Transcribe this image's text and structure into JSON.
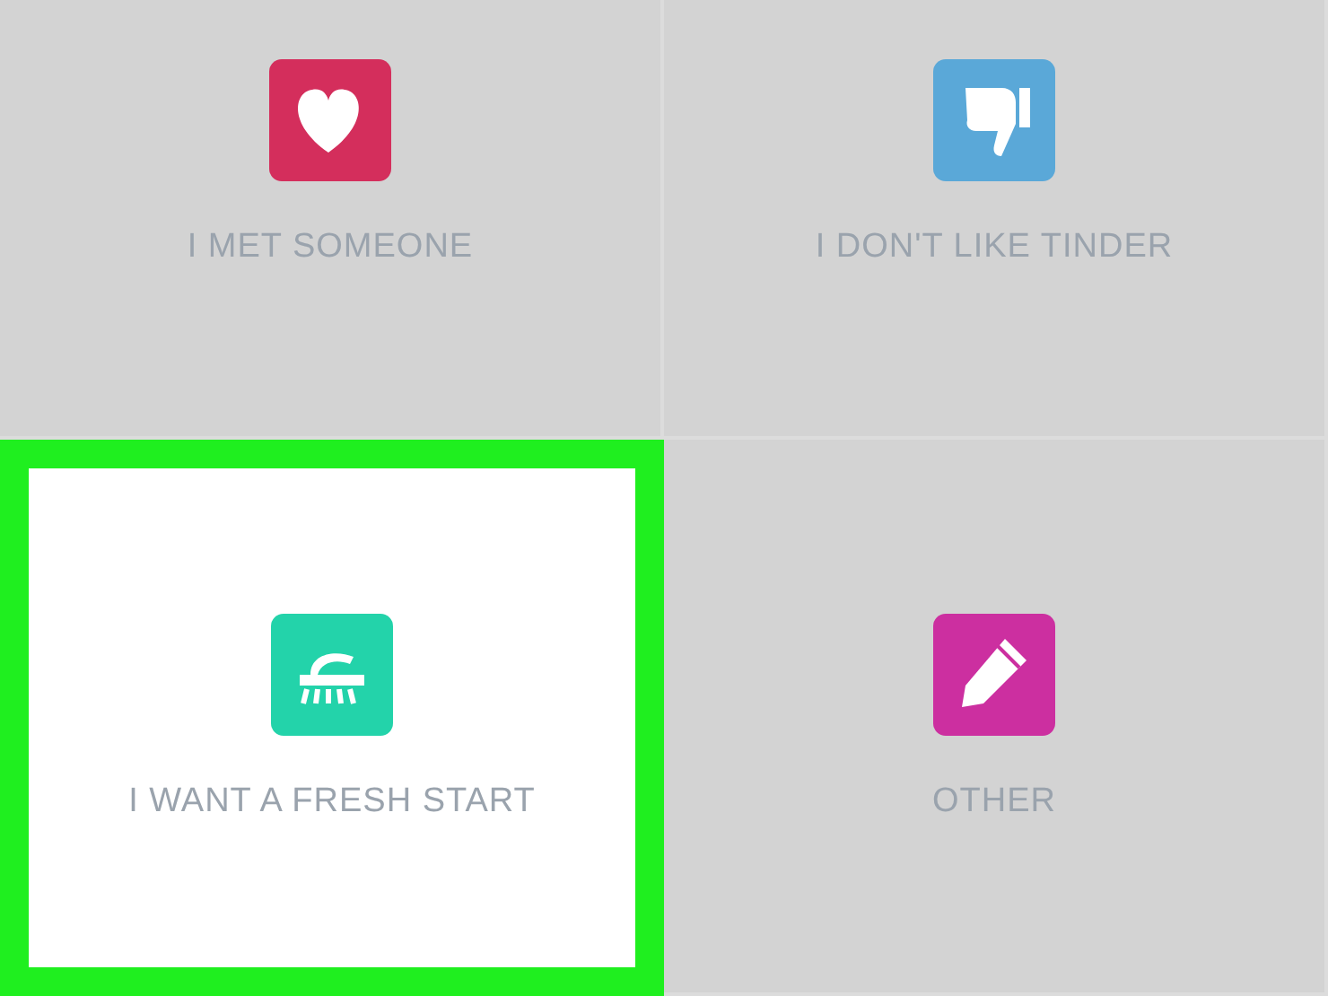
{
  "options": [
    {
      "label": "I MET SOMEONE",
      "kind": "heart",
      "selected": false
    },
    {
      "label": "I DON'T LIKE TINDER",
      "kind": "thumbs-down",
      "selected": false
    },
    {
      "label": "I WANT A FRESH START",
      "kind": "brush",
      "selected": true
    },
    {
      "label": "OTHER",
      "kind": "pencil",
      "selected": false
    }
  ]
}
